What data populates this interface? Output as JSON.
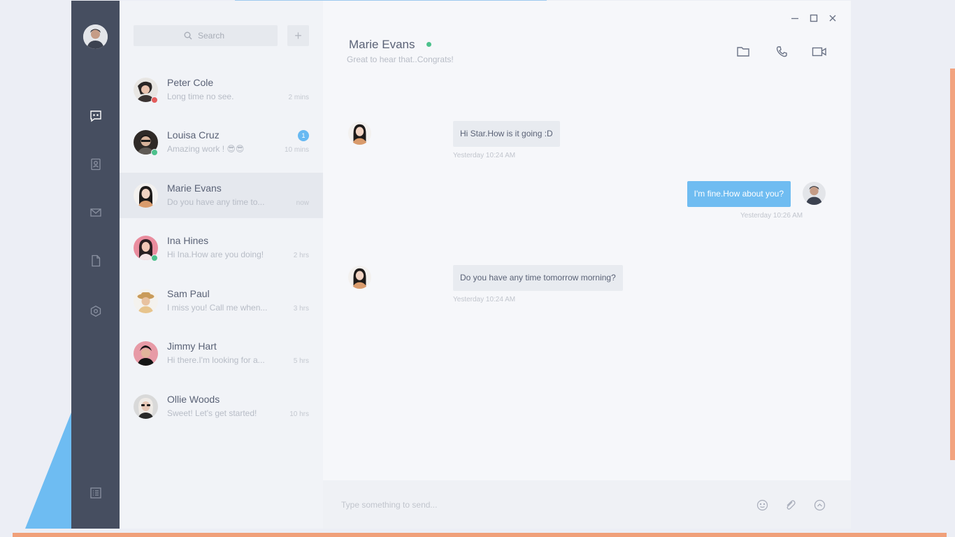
{
  "search": {
    "placeholder": "Search",
    "add_label": "+"
  },
  "contacts": [
    {
      "name": "Peter Cole",
      "message": "Long time no see.",
      "time": "2 mins",
      "status_color": "#e35d5d",
      "badge": ""
    },
    {
      "name": "Louisa Cruz",
      "message": "Amazing work ! 😎😎",
      "time": "10 mins",
      "status_color": "#4cc18c",
      "badge": "1"
    },
    {
      "name": "Marie Evans",
      "message": "Do you have any time to...",
      "time": "now",
      "status_color": "",
      "badge": ""
    },
    {
      "name": "Ina Hines",
      "message": "Hi Ina.How are you doing!",
      "time": "2 hrs",
      "status_color": "#4cc18c",
      "badge": ""
    },
    {
      "name": "Sam Paul",
      "message": "I miss you! Call me when...",
      "time": "3 hrs",
      "status_color": "",
      "badge": ""
    },
    {
      "name": "Jimmy Hart",
      "message": "Hi there.I'm looking for a...",
      "time": "5 hrs",
      "status_color": "",
      "badge": ""
    },
    {
      "name": "Ollie Woods",
      "message": "Sweet! Let's get started!",
      "time": "10 hrs",
      "status_color": "",
      "badge": ""
    }
  ],
  "chat": {
    "name": "Marie Evans",
    "subtitle": "Great to hear that..Congrats!",
    "messages": [
      {
        "direction": "in",
        "text": "Hi Star.How is it going :D",
        "time": "Yesterday 10:24 AM"
      },
      {
        "direction": "out",
        "text": "I'm fine.How about you?",
        "time": "Yesterday 10:26 AM"
      },
      {
        "direction": "in",
        "text": "Do you have any time tomorrow morning?",
        "time": "Yesterday 10:24 AM"
      }
    ]
  },
  "composer": {
    "placeholder": "Type something to send..."
  },
  "icons": {
    "sidebar": [
      "chat-icon",
      "contacts-icon",
      "mail-icon",
      "document-icon",
      "settings-icon",
      "list-icon"
    ],
    "header": [
      "folder-icon",
      "phone-icon",
      "video-icon"
    ],
    "window": [
      "minimize-icon",
      "maximize-icon",
      "close-icon"
    ],
    "composer": [
      "emoji-icon",
      "attach-icon",
      "send-icon"
    ]
  },
  "colors": {
    "sidebar": "#464e60",
    "accent_blue": "#6fbcf1",
    "online_green": "#4cc18c",
    "away_red": "#e35d5d",
    "decor_orange": "#f0a07a",
    "decor_triangle": "#6ebcf2"
  }
}
